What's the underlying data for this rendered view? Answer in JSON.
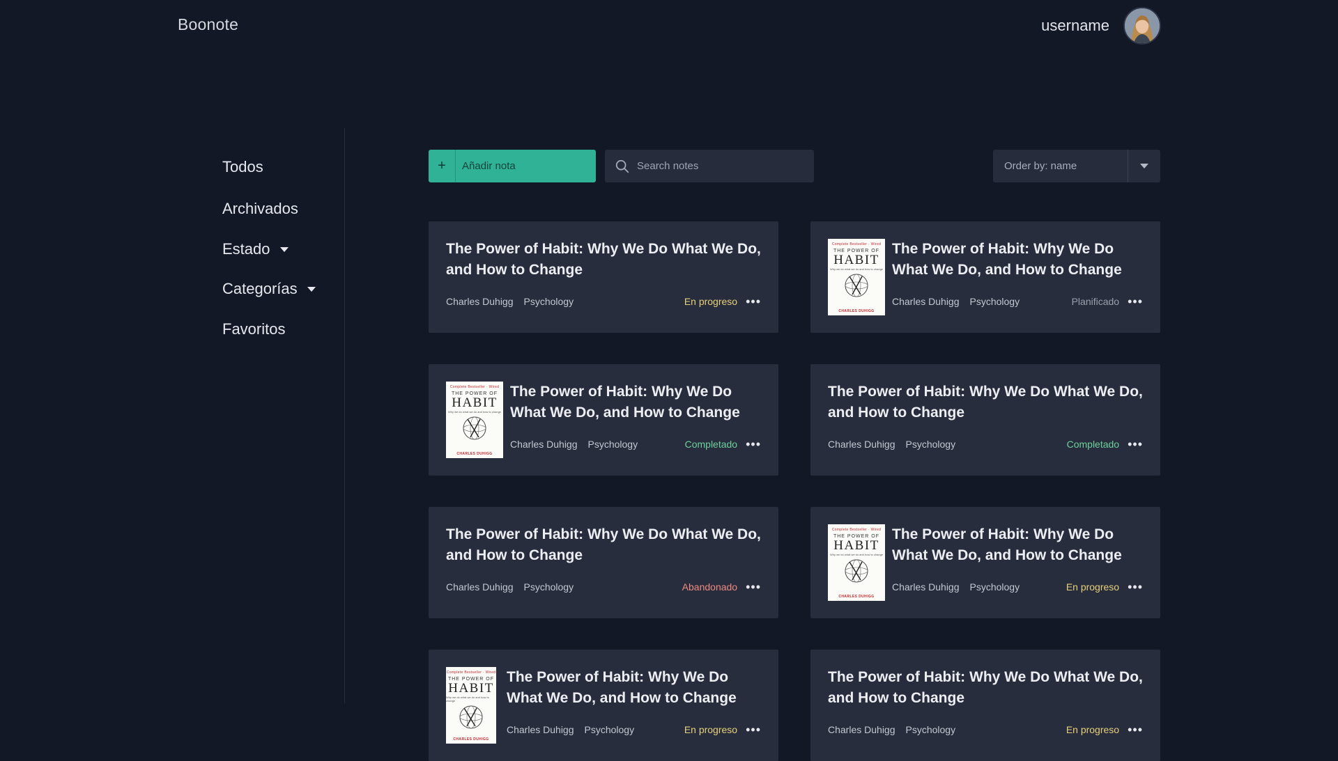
{
  "header": {
    "brand": "Boonote",
    "username": "username"
  },
  "sidebar": {
    "items": [
      {
        "label": "Todos"
      },
      {
        "label": "Archivados"
      },
      {
        "label": "Estado"
      },
      {
        "label": "Categorías"
      },
      {
        "label": "Favoritos"
      }
    ]
  },
  "toolbar": {
    "add_label": "Añadir nota",
    "add_icon": "+",
    "search_placeholder": "Search notes",
    "order_label": "Order by: name"
  },
  "cover": {
    "top": "Complete Bestseller · Wired",
    "the": "THE POWER OF",
    "habit": "HABIT",
    "sub": "Why we do what we do and how to change",
    "author": "CHARLES DUHIGG"
  },
  "notes": [
    {
      "title": "The Power of Habit: Why We Do What We Do, and How to Change",
      "author": "Charles Duhigg",
      "category": "Psychology",
      "status": "En progreso",
      "cover": false
    },
    {
      "title": "The Power of Habit: Why We Do What We Do, and How to Change",
      "author": "Charles Duhigg",
      "category": "Psychology",
      "status": "Planificado",
      "cover": true
    },
    {
      "title": "The Power of Habit: Why We Do What We Do, and How to Change",
      "author": "Charles Duhigg",
      "category": "Psychology",
      "status": "Completado",
      "cover": true
    },
    {
      "title": "The Power of Habit: Why We Do What We Do, and How to Change",
      "author": "Charles Duhigg",
      "category": "Psychology",
      "status": "Completado",
      "cover": false
    },
    {
      "title": "The Power of Habit: Why We Do What We Do, and How to Change",
      "author": "Charles Duhigg",
      "category": "Psychology",
      "status": "Abandonado",
      "cover": false
    },
    {
      "title": "The Power of Habit: Why We Do What We Do, and How to Change",
      "author": "Charles Duhigg",
      "category": "Psychology",
      "status": "En progreso",
      "cover": true
    },
    {
      "title": "The Power of Habit: Why We Do What We Do, and How to Change",
      "author": "Charles Duhigg",
      "category": "Psychology",
      "status": "En progreso",
      "cover": true
    },
    {
      "title": "The Power of Habit: Why We Do What We Do, and How to Change",
      "author": "Charles Duhigg",
      "category": "Psychology",
      "status": "En progreso",
      "cover": false
    }
  ],
  "colors": {
    "accent": "#2fb296",
    "status_progress": "#e7d07a",
    "status_planned": "#9aa0ac",
    "status_done": "#6ed19c",
    "status_abandoned": "#ef8a80"
  }
}
